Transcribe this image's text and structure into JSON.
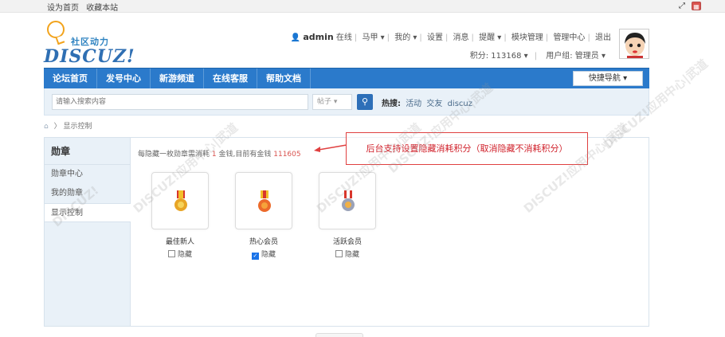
{
  "topbar": {
    "set_home": "设为首页",
    "bookmark": "收藏本站"
  },
  "logo": {
    "cn": "社区动力",
    "en": "DISCUZ!"
  },
  "user": {
    "name": "admin",
    "status": "在线",
    "menu": [
      "马甲",
      "我的",
      "设置",
      "消息",
      "提醒",
      "模块管理",
      "管理中心",
      "退出"
    ],
    "points_label": "积分: 113168",
    "group_label": "用户组: 管理员"
  },
  "nav": {
    "items": [
      "论坛首页",
      "发号中心",
      "新游频道",
      "在线客服",
      "帮助文档"
    ],
    "quick": "快捷导航"
  },
  "search": {
    "placeholder": "请输入搜索内容",
    "type": "帖子",
    "hot_label": "热搜:",
    "hot": [
      "活动",
      "交友",
      "discuz"
    ]
  },
  "breadcrumb": {
    "current": "显示控制"
  },
  "sidebar": {
    "title": "勋章",
    "links": [
      "勋章中心",
      "我的勋章",
      "显示控制"
    ]
  },
  "tip": {
    "prefix": "每隐藏一枚勋章需消耗",
    "cost": "1",
    "mid": "金钱,目前有金钱",
    "balance": "111605"
  },
  "medals": [
    {
      "name": "最佳新人",
      "hide_label": "隐藏",
      "checked": false
    },
    {
      "name": "热心会员",
      "hide_label": "隐藏",
      "checked": true
    },
    {
      "name": "活跃会员",
      "hide_label": "隐藏",
      "checked": false
    }
  ],
  "annotation": "后台支持设置隐藏消耗积分（取消隐藏不消耗积分）",
  "colors": {
    "nav": "#2b7acb",
    "accent_red": "#d0202a",
    "sidebar_bg": "#e9f1f8"
  }
}
